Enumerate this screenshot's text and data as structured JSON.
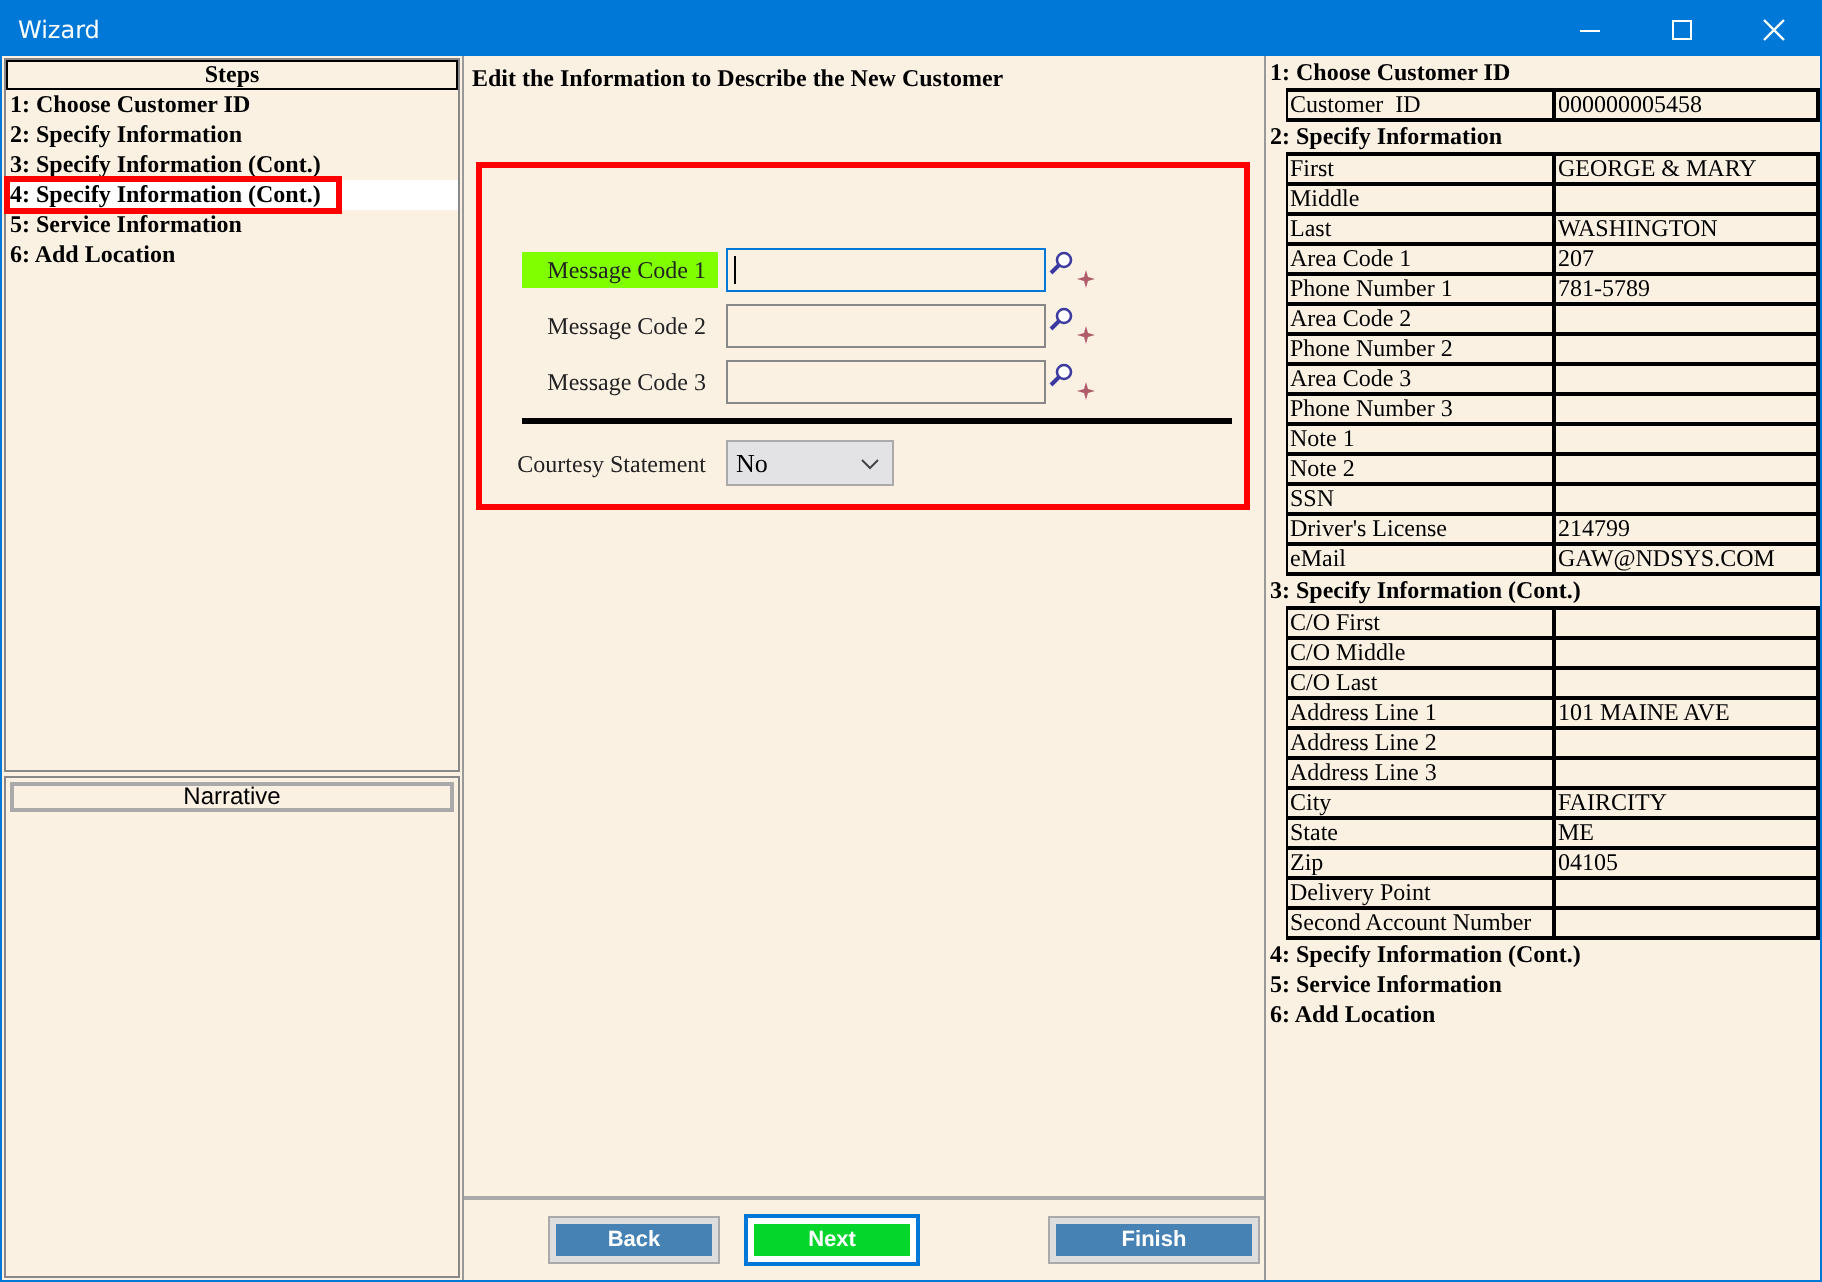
{
  "window": {
    "title": "Wizard"
  },
  "steps": {
    "title": "Steps",
    "items": [
      {
        "label": "1: Choose Customer ID",
        "selected": false
      },
      {
        "label": "2: Specify Information",
        "selected": false
      },
      {
        "label": "3: Specify Information (Cont.)",
        "selected": false
      },
      {
        "label": "4: Specify Information (Cont.)",
        "selected": true
      },
      {
        "label": "5: Service Information",
        "selected": false
      },
      {
        "label": "6: Add Location",
        "selected": false
      }
    ]
  },
  "narrative": {
    "title": "Narrative"
  },
  "form": {
    "heading": "Edit the Information to Describe the New Customer",
    "fields": [
      {
        "label": "Message Code 1",
        "focused": true
      },
      {
        "label": "Message Code 2",
        "focused": false
      },
      {
        "label": "Message Code 3",
        "focused": false
      }
    ],
    "courtesy": {
      "label": "Courtesy Statement",
      "value": "No"
    }
  },
  "buttons": [
    {
      "label": "Back",
      "primary": false
    },
    {
      "label": "Next",
      "primary": true
    },
    {
      "label": "Finish",
      "primary": false
    }
  ],
  "summary": [
    {
      "title": "1: Choose Customer ID",
      "rows": [
        {
          "label": "Customer  ID",
          "value": "000000005458"
        }
      ]
    },
    {
      "title": "2: Specify Information",
      "rows": [
        {
          "label": "First",
          "value": "GEORGE & MARY"
        },
        {
          "label": "Middle"
        },
        {
          "label": "Last",
          "value": "WASHINGTON"
        },
        {
          "label": "Area Code 1",
          "value": "207"
        },
        {
          "label": "Phone Number 1",
          "value": "781-5789"
        },
        {
          "label": "Area Code 2"
        },
        {
          "label": "Phone Number 2"
        },
        {
          "label": "Area Code 3"
        },
        {
          "label": "Phone Number 3"
        },
        {
          "label": "Note 1"
        },
        {
          "label": "Note 2"
        },
        {
          "label": "SSN"
        },
        {
          "label": "Driver's License",
          "value": "214799"
        },
        {
          "label": "eMail",
          "value": "GAW@NDSYS.COM"
        }
      ]
    },
    {
      "title": "3: Specify Information (Cont.)",
      "rows": [
        {
          "label": "C/O First"
        },
        {
          "label": "C/O Middle"
        },
        {
          "label": "C/O Last"
        },
        {
          "label": "Address Line 1",
          "value": "101 MAINE AVE"
        },
        {
          "label": "Address Line 2"
        },
        {
          "label": "Address Line 3"
        },
        {
          "label": "City",
          "value": "FAIRCITY"
        },
        {
          "label": "State",
          "value": "ME"
        },
        {
          "label": "Zip",
          "value": "04105"
        },
        {
          "label": "Delivery Point"
        },
        {
          "label": "Second Account Number"
        }
      ]
    },
    {
      "title": "4: Specify Information (Cont.)"
    },
    {
      "title": "5: Service Information"
    },
    {
      "title": "6: Add Location"
    }
  ]
}
